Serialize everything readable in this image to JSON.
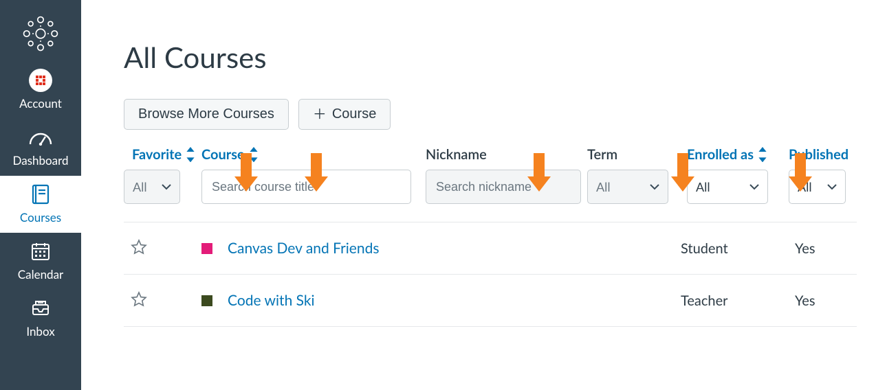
{
  "sidebar": {
    "items": [
      {
        "key": "account",
        "label": "Account"
      },
      {
        "key": "dashboard",
        "label": "Dashboard"
      },
      {
        "key": "courses",
        "label": "Courses"
      },
      {
        "key": "calendar",
        "label": "Calendar"
      },
      {
        "key": "inbox",
        "label": "Inbox"
      }
    ]
  },
  "page": {
    "title": "All Courses"
  },
  "toolbar": {
    "browse_label": "Browse More Courses",
    "addcourse_label": "Course"
  },
  "columns": {
    "favorite": {
      "label": "Favorite",
      "select_value": "All"
    },
    "course": {
      "label": "Course",
      "placeholder": "Search course title",
      "value": ""
    },
    "nickname": {
      "label": "Nickname",
      "placeholder": "Search nickname",
      "value": ""
    },
    "term": {
      "label": "Term",
      "select_value": "All"
    },
    "enrolled": {
      "label": "Enrolled as",
      "select_value": "All"
    },
    "published": {
      "label": "Published",
      "select_value": "All"
    }
  },
  "rows": [
    {
      "favorite": false,
      "swatch": "#E31C79",
      "title": "Canvas Dev and Friends",
      "nickname": "",
      "term": "",
      "enrolled_as": "Student",
      "published": "Yes"
    },
    {
      "favorite": false,
      "swatch": "#4b5320",
      "title": "Code with Ski",
      "nickname": "",
      "term": "",
      "enrolled_as": "Teacher",
      "published": "Yes"
    }
  ]
}
